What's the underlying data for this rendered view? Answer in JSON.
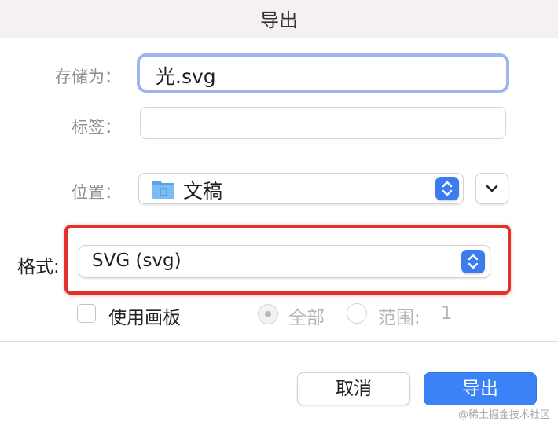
{
  "dialog": {
    "title": "导出",
    "save_as": {
      "label": "存储为：",
      "value": "光.svg"
    },
    "tags": {
      "label": "标签：",
      "value": ""
    },
    "location": {
      "label": "位置：",
      "value": "文稿"
    },
    "format": {
      "label": "格式:",
      "value": "SVG (svg)"
    },
    "artboards": {
      "checkbox_label": "使用画板",
      "checked": false,
      "option_all": "全部",
      "option_range": "范围:",
      "range_value": "1"
    },
    "buttons": {
      "cancel": "取消",
      "export": "导出"
    }
  },
  "watermark": "@稀土掘金技术社区",
  "colors": {
    "accent": "#3b82f6",
    "highlight_box": "#e4302b",
    "focus_ring": "#9fb3ee",
    "label": "#8f8f8f"
  },
  "icons": [
    "folder-icon",
    "stepper-updown-icon",
    "chevron-down-icon",
    "checkbox-icon",
    "radio-icon"
  ]
}
